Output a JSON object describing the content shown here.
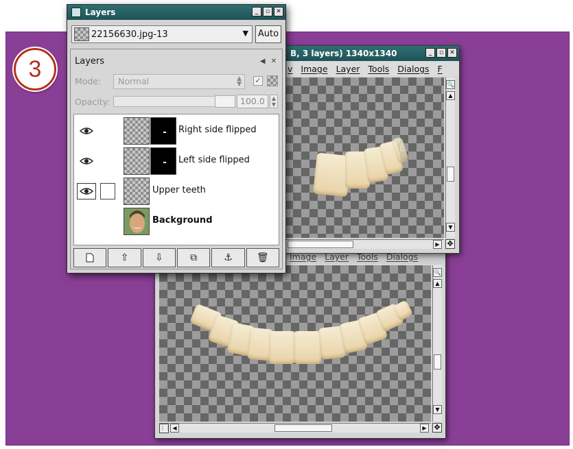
{
  "step": {
    "number": "3"
  },
  "layers_dialog": {
    "title": "Layers",
    "image_selector": "22156630.jpg-13",
    "auto_label": "Auto",
    "panel_title": "Layers",
    "mode_label": "Mode:",
    "mode_value": "Normal",
    "opacity_label": "Opacity:",
    "opacity_value": "100.0",
    "layers": [
      {
        "name": "Right side flipped",
        "visible": true,
        "has_mask": true
      },
      {
        "name": "Left side flipped",
        "visible": true,
        "has_mask": true
      },
      {
        "name": "Upper teeth",
        "visible": true,
        "has_mask": false
      },
      {
        "name": "Background",
        "visible": false,
        "has_mask": false,
        "bold": true
      }
    ],
    "toolbar_icons": [
      "new-layer-icon",
      "raise-layer-icon",
      "lower-layer-icon",
      "duplicate-layer-icon",
      "anchor-layer-icon",
      "delete-layer-icon"
    ]
  },
  "image_window_top": {
    "title": "B, 3 layers) 1340x1340",
    "menu": [
      "v",
      "Image",
      "Layer",
      "Tools",
      "Dialogs",
      "F"
    ]
  },
  "image_window_bottom": {
    "menu": [
      "Image",
      "Layer",
      "Tools",
      "Dialogs"
    ]
  },
  "colors": {
    "backdrop": "#8a3f97",
    "titlebar": "#2f6f72",
    "badge": "#b5301f"
  }
}
